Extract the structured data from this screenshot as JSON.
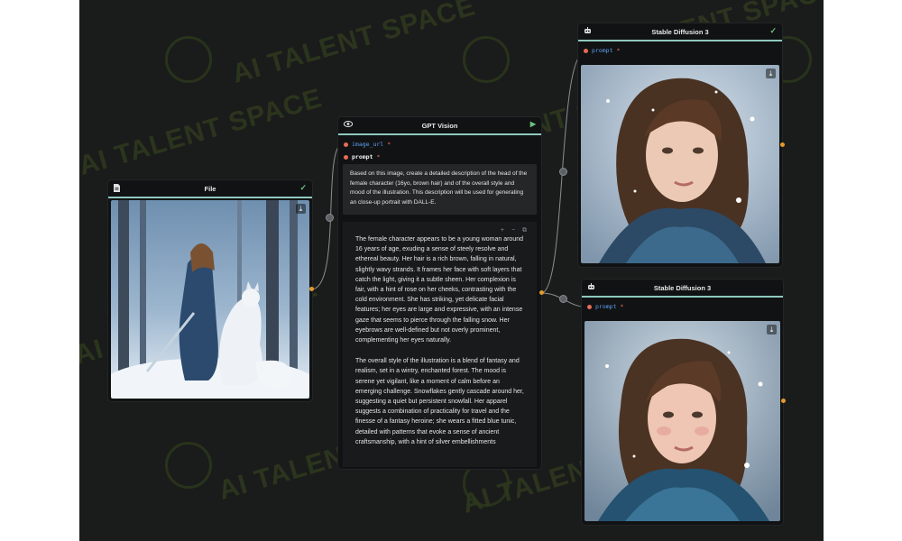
{
  "watermark": {
    "text": "AI TALENT SPACE"
  },
  "nodes": {
    "file": {
      "title": "File",
      "status_icon": "check-icon"
    },
    "gpt_vision": {
      "title": "GPT Vision",
      "ports": [
        {
          "name": "image_url",
          "required": "*"
        },
        {
          "name": "prompt",
          "required": "*"
        }
      ],
      "prompt_text": "Based on this image, create a detailed description of the head of the female character (16yo, brown hair) and of the overall style and mood of the illustration. This description will be used for generating an close-up portrait with DALL-E.",
      "output_tools": "+ − ⧉",
      "output_paragraphs": [
        "The female character appears to be a young woman around 16 years of age, exuding a sense of steely resolve and ethereal beauty. Her hair is a rich brown, falling in natural, slightly wavy strands. It frames her face with soft layers that catch the light, giving it a subtle sheen. Her complexion is fair, with a hint of rose on her cheeks, contrasting with the cold environment. She has striking, yet delicate facial features; her eyes are large and expressive, with an intense gaze that seems to pierce through the falling snow. Her eyebrows are well-defined but not overly prominent, complementing her eyes naturally.",
        "The overall style of the illustration is a blend of fantasy and realism, set in a wintry, enchanted forest. The mood is serene yet vigilant, like a moment of calm before an emerging challenge. Snowflakes gently cascade around her, suggesting a quiet but persistent snowfall. Her apparel suggests a combination of practicality for travel and the finesse of a fantasy heroine; she wears a fitted blue tunic, detailed with patterns that evoke a sense of ancient craftsmanship, with a hint of silver embellishments"
      ]
    },
    "sd_top": {
      "title": "Stable Diffusion 3",
      "port": {
        "name": "prompt",
        "required": "*"
      }
    },
    "sd_bottom": {
      "title": "Stable Diffusion 3",
      "port": {
        "name": "prompt",
        "required": "*"
      }
    }
  },
  "colors": {
    "accent": "#8ec9bf",
    "port_required": "#e46c57",
    "port_name": "#5ea1f3",
    "handle": "#e39a2d",
    "canvas": "#1a1c1b"
  }
}
